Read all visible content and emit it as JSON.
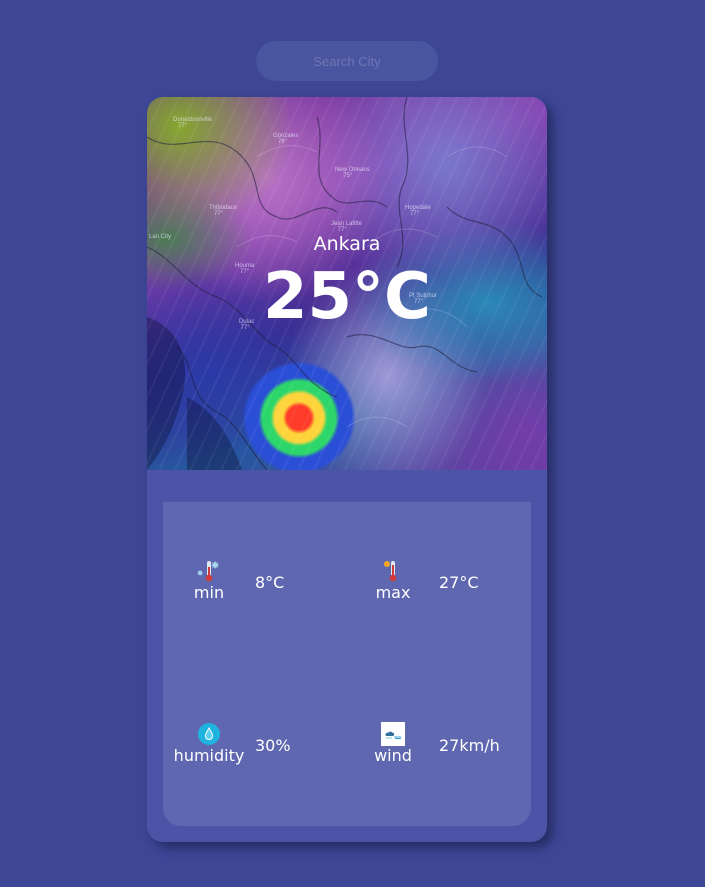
{
  "search": {
    "placeholder": "Search City"
  },
  "weather": {
    "city": "Ankara",
    "temperature": "25°C"
  },
  "stats": {
    "min": {
      "label": "min",
      "value": "8°C",
      "icon": "cold-thermometer-icon"
    },
    "max": {
      "label": "max",
      "value": "27°C",
      "icon": "hot-thermometer-icon"
    },
    "humidity": {
      "label": "humidity",
      "value": "30%",
      "icon": "water-drop-icon"
    },
    "wind": {
      "label": "wind",
      "value": "27km/h",
      "icon": "wind-cloud-icon"
    }
  },
  "colors": {
    "background": "#3d4796",
    "card": "#4b54a6",
    "panel": "#5f67b1"
  }
}
